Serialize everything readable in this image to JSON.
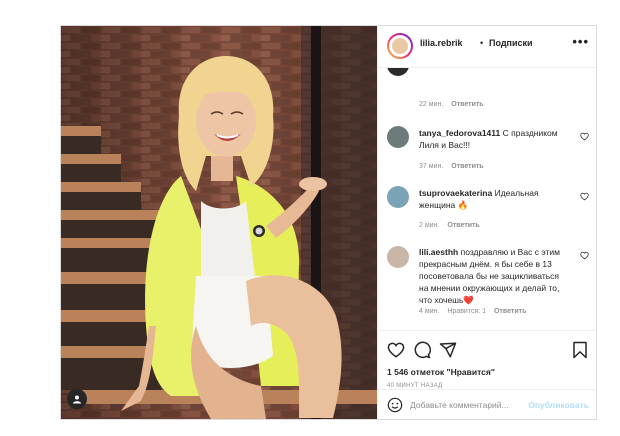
{
  "header": {
    "username": "lilia.rebrik",
    "separator": "•",
    "follow_label": "Подписки",
    "more_icon": "more-horizontal-icon"
  },
  "comments": [
    {
      "username": "",
      "text": "",
      "time": "22 мин.",
      "likes": "",
      "reply_label": "Ответить",
      "avatar_color": "#2b2b2b"
    },
    {
      "username": "tanya_fedorova1411",
      "text": "С праздником Лиля и Вас!!!",
      "time": "37 мин.",
      "likes": "",
      "reply_label": "Ответить",
      "avatar_color": "#6d7b7a"
    },
    {
      "username": "tsuprovaekaterina",
      "text": "Идеальная женщина 🔥",
      "time": "2 мин.",
      "likes": "",
      "reply_label": "Ответить",
      "avatar_color": "#7aa3b8"
    },
    {
      "username": "lili.aesthh",
      "text": "поздравляю и Вас с этим прекрасным днём. я бы себе в 13 посоветовала бы не зацикливаться на мнении окружающих и делай то, что хочешь❤️",
      "time": "4 мин.",
      "likes": "Нравится: 1",
      "reply_label": "Ответить",
      "avatar_color": "#c9b6a6"
    }
  ],
  "actions": {
    "like_icon": "heart-icon",
    "comment_icon": "comment-icon",
    "share_icon": "share-icon",
    "save_icon": "bookmark-icon"
  },
  "likes_text": "1 546 отметок \"Нравится\"",
  "time_ago": "40 минут назад",
  "comment_box": {
    "placeholder": "Добавьте комментарий...",
    "publish_label": "Опубликовать",
    "emoji_icon": "smiley-icon"
  },
  "colors": {
    "accent_disabled": "#b2dffc",
    "text": "#262626",
    "secondary_text": "#8e8e8e",
    "heart": "#ed4956"
  }
}
